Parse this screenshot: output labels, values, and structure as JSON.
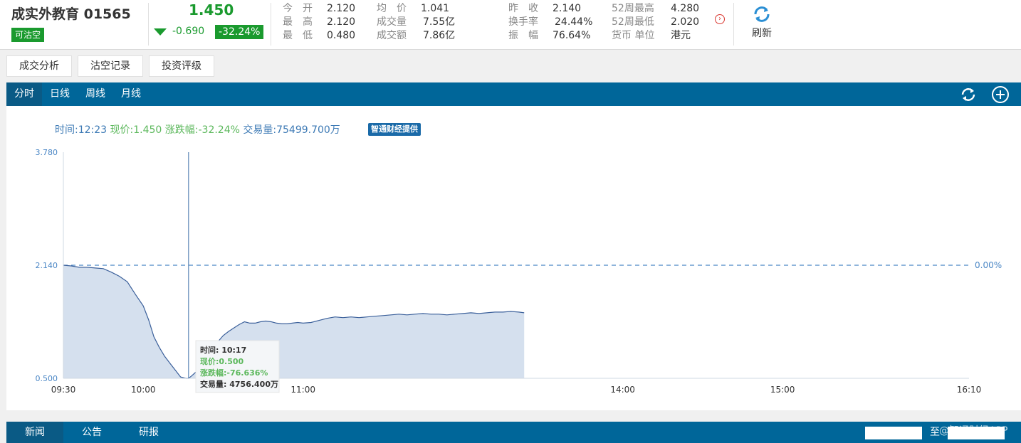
{
  "header": {
    "stock_name": "成实外教育 01565",
    "short_badge": "可沽空",
    "price": "1.450",
    "change": "-0.690",
    "change_pct": "-32.24%",
    "refresh_label": "刷新",
    "stats": [
      {
        "label": "今　开",
        "value": "2.120"
      },
      {
        "label": "最　高",
        "value": "2.120"
      },
      {
        "label": "最　低",
        "value": "0.480"
      },
      {
        "label": "均　价",
        "value": "1.041"
      },
      {
        "label": "成交量",
        "value": "7.55亿"
      },
      {
        "label": "成交额",
        "value": "7.86亿"
      },
      {
        "label": "昨　收",
        "value": "2.140"
      },
      {
        "label": "换手率",
        "value": "24.44%"
      },
      {
        "label": "振　幅",
        "value": "76.64%"
      },
      {
        "label": "52周最高",
        "value": "4.280"
      },
      {
        "label": "52周最低",
        "value": "2.020"
      },
      {
        "label": "货币 单位",
        "value": "港元"
      }
    ]
  },
  "analysis_tabs": [
    "成交分析",
    "沽空记录",
    "投资评级"
  ],
  "period_tabs": [
    "分时",
    "日线",
    "周线",
    "月线"
  ],
  "info_line": {
    "time": "时间:12:23",
    "price": "现价:1.450",
    "change": "涨跌幅:-32.24%",
    "volume": "交易量:75499.700万",
    "provider": "智通财经提供"
  },
  "tooltip": {
    "time": "时间: 10:17",
    "price": "现价:0.500",
    "change": "涨跌幅:-76.636%",
    "volume": "交易量: 4756.400万"
  },
  "news_tabs": [
    "新闻",
    "公告",
    "研报"
  ],
  "date_to_label": "至",
  "watermark": "@智通财经APP",
  "colors": {
    "up": "#d9362f",
    "down": "#1a9a2e",
    "accent": "#006699",
    "area": "#d5e0ee",
    "line": "#3a5f9a"
  },
  "chart_data": {
    "type": "area",
    "ylim": [
      0.5,
      3.78
    ],
    "yticks": [
      "3.780",
      "2.140",
      "0.500"
    ],
    "prev_close": 2.14,
    "prev_close_label": "0.00%",
    "xticks": [
      "09:30",
      "10:00",
      "11:00",
      "14:00",
      "15:00",
      "16:10"
    ],
    "crosshair_time": "10:17",
    "x": [
      "09:30",
      "09:33",
      "09:36",
      "09:39",
      "09:42",
      "09:45",
      "09:48",
      "09:51",
      "09:54",
      "09:57",
      "10:00",
      "10:02",
      "10:04",
      "10:06",
      "10:08",
      "10:10",
      "10:12",
      "10:14",
      "10:16",
      "10:17",
      "10:18",
      "10:20",
      "10:22",
      "10:24",
      "10:26",
      "10:28",
      "10:30",
      "10:32",
      "10:34",
      "10:36",
      "10:38",
      "10:40",
      "10:42",
      "10:44",
      "10:46",
      "10:48",
      "10:50",
      "10:52",
      "10:54",
      "10:56",
      "10:58",
      "11:00",
      "11:03",
      "11:06",
      "11:09",
      "11:12",
      "11:15",
      "11:18",
      "11:21",
      "11:24",
      "11:27",
      "11:30",
      "11:33",
      "11:36",
      "11:39",
      "11:42",
      "11:45",
      "11:48",
      "11:51",
      "11:54",
      "11:57",
      "12:00",
      "12:03",
      "12:06",
      "12:09",
      "12:12",
      "12:15",
      "12:18",
      "12:21",
      "12:23"
    ],
    "values": [
      2.14,
      2.13,
      2.11,
      2.11,
      2.1,
      2.09,
      2.04,
      1.98,
      1.9,
      1.72,
      1.55,
      1.35,
      1.1,
      0.95,
      0.82,
      0.72,
      0.62,
      0.52,
      0.5,
      0.5,
      0.53,
      0.6,
      0.72,
      0.85,
      0.95,
      1.03,
      1.12,
      1.18,
      1.23,
      1.28,
      1.32,
      1.3,
      1.3,
      1.32,
      1.33,
      1.32,
      1.3,
      1.29,
      1.29,
      1.3,
      1.31,
      1.3,
      1.31,
      1.34,
      1.37,
      1.39,
      1.38,
      1.39,
      1.38,
      1.39,
      1.4,
      1.41,
      1.42,
      1.43,
      1.42,
      1.43,
      1.44,
      1.43,
      1.43,
      1.42,
      1.43,
      1.44,
      1.45,
      1.44,
      1.45,
      1.46,
      1.46,
      1.47,
      1.46,
      1.45
    ]
  }
}
